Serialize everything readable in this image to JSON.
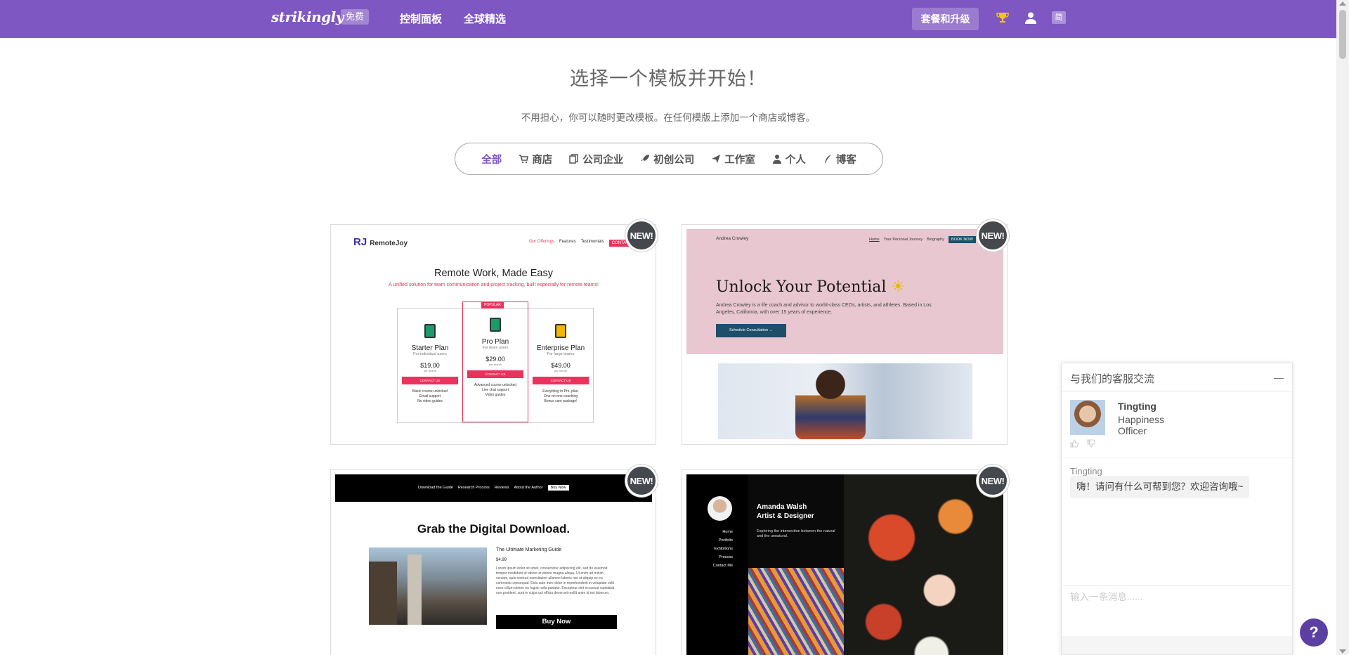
{
  "navbar": {
    "logo": "strikingly",
    "free_badge": "免费",
    "links": [
      "控制面板",
      "全球精选"
    ],
    "upgrade_label": "套餐和升级",
    "lang_label": "简",
    "bg_color": "#7e57c2"
  },
  "header": {
    "title": "选择一个模板并开始！",
    "subtitle": "不用担心，你可以随时更改模板。在任何模版上添加一个商店或博客。"
  },
  "filters": [
    {
      "label": "全部",
      "icon": "none",
      "active": true
    },
    {
      "label": "商店",
      "icon": "cart-icon",
      "active": false
    },
    {
      "label": "公司企业",
      "icon": "copy-icon",
      "active": false
    },
    {
      "label": "初创公司",
      "icon": "rocket-icon",
      "active": false
    },
    {
      "label": "工作室",
      "icon": "paper-plane-icon",
      "active": false
    },
    {
      "label": "个人",
      "icon": "user-icon",
      "active": false
    },
    {
      "label": "博客",
      "icon": "quill-icon",
      "active": false
    }
  ],
  "templates": {
    "new_badge": "NEW!",
    "remotejoy": {
      "brand": "RemoteJoy",
      "menu": [
        "Our Offerings",
        "Features",
        "Testimonials",
        "CONTACT US"
      ],
      "title": "Remote Work, Made Easy",
      "subtitle": "A unified solution for team communication and project tracking, built especially for remote teams!",
      "popular": "POPULAR",
      "plans": [
        {
          "name": "Starter Plan",
          "for": "For individual users",
          "price": "$19.00",
          "per": "per month",
          "btn": "CONTACT US",
          "features": [
            "Basic course unlocked",
            "Email support",
            "No video guides"
          ]
        },
        {
          "name": "Pro Plan",
          "for": "For team users",
          "price": "$29.00",
          "per": "per month",
          "btn": "CONTACT US",
          "features": [
            "Advanced course unlocked",
            "Live chat support",
            "Video guides"
          ]
        },
        {
          "name": "Enterprise Plan",
          "for": "For large teams",
          "price": "$49.00",
          "per": "per month",
          "btn": "CONTACT US",
          "features": [
            "Everything in Pro, plus:",
            "One-on-one coaching",
            "Bonus care package!"
          ]
        }
      ]
    },
    "andrea": {
      "name": "Andrea Crowley",
      "menu": [
        "Home",
        "Your Personal Journey",
        "Biography",
        "BOOK NOW"
      ],
      "title": "Unlock Your Potential",
      "desc": "Andrea Crowley is a life coach and advisor to world-class CEOs, artists, and athletes. Based in Los Angeles, California, with over 15 years of experience.",
      "btn": "Schedule Consultation →"
    },
    "digital": {
      "menu": [
        "Download the Guide",
        "Research Process",
        "Reviews",
        "About the Author",
        "Buy Now"
      ],
      "title": "Grab the Digital Download.",
      "guide": "The Ultimate Marketing Guide",
      "price": "$4.99",
      "lorem": "Lorem ipsum dolor sit amet, consectetur adipiscing elit, sed do eiusmod tempor incididunt ut labore et dolore magna aliqua. Ut enim ad minim veniam, quis nostrud exercitation ullamco laboris nisi ut aliquip ex ea commodo consequat. Duis aute irure dolor in reprehenderit in voluptate velit esse cillum dolore eu fugiat nulla pariatur. Excepteur sint occaecat cupidatat non proident, sunt in culpa qui officia deserunt mollit anim id est laborum.",
      "buy": "Buy Now"
    },
    "amanda": {
      "nav": [
        "Home",
        "Portfolio",
        "Exhibitions",
        "Process",
        "Contact Me"
      ],
      "name": "Amanda Walsh",
      "role": "Artist & Designer",
      "desc": "Exploring the intersection between the natural and the unnatural."
    }
  },
  "chat": {
    "title": "与我们的客服交流",
    "minimize": "—",
    "agent_name": "Tingting",
    "agent_role": "Happiness Officer",
    "sender": "Tingting",
    "message": "嗨！请问有什么可帮到您？欢迎咨询哦~",
    "placeholder": "输入一条消息......"
  },
  "help": "?"
}
